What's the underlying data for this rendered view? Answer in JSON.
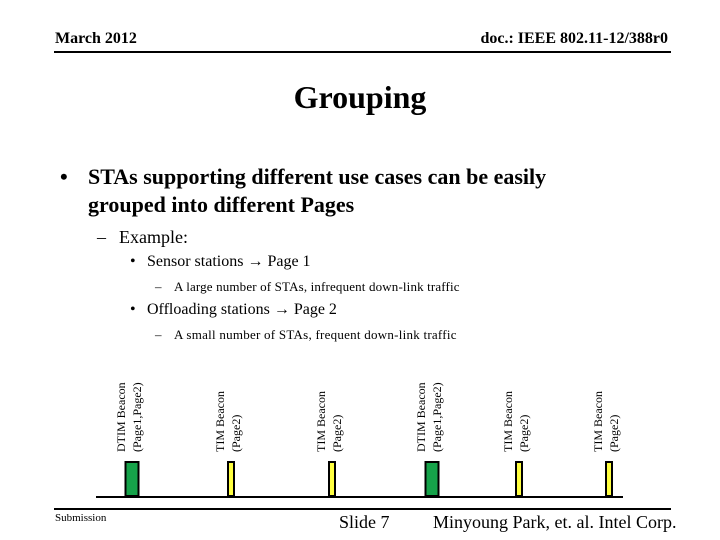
{
  "header": {
    "date": "March 2012",
    "doc_id": "doc.: IEEE 802.11-12/388r0"
  },
  "title": "Grouping",
  "body": {
    "main_bullet": {
      "line1": "STAs supporting different use cases can be easily",
      "line2": "grouped into different Pages"
    },
    "example_label": "Example:",
    "items": [
      {
        "label": "Sensor stations",
        "arrow": "→",
        "target": "Page 1",
        "detail": "A large number of STAs, infrequent down-link traffic"
      },
      {
        "label": "Offloading stations",
        "arrow": "→",
        "target": "Page 2",
        "detail": "A small number of STAs, frequent down-link traffic"
      }
    ],
    "glyphs": {
      "bullet": "•",
      "dash": "–"
    }
  },
  "diagram": {
    "colors": {
      "dtim": "#16a34a",
      "tim": "#ffff40",
      "outline": "#000000"
    },
    "beacons": [
      {
        "type": "dtim",
        "line1": "DTIM Beacon",
        "line2": "(Page1,Page2)"
      },
      {
        "type": "tim",
        "line1": "TIM Beacon",
        "line2": "(Page2)"
      },
      {
        "type": "tim",
        "line1": "TIM Beacon",
        "line2": "(Page2)"
      },
      {
        "type": "dtim",
        "line1": "DTIM Beacon",
        "line2": "(Page1,Page2)"
      },
      {
        "type": "tim",
        "line1": "TIM Beacon",
        "line2": "(Page2)"
      },
      {
        "type": "tim",
        "line1": "TIM Beacon",
        "line2": "(Page2)"
      }
    ]
  },
  "footer": {
    "left": "Submission",
    "center": "Slide 7",
    "right": "Minyoung Park, et. al. Intel Corp."
  }
}
